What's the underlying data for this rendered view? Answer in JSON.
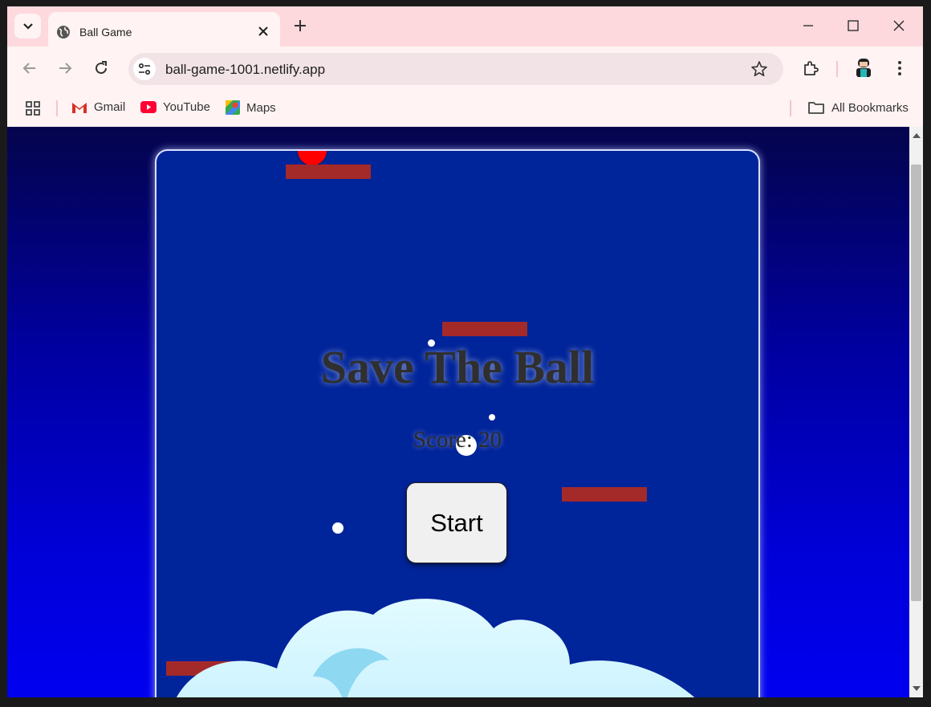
{
  "browser": {
    "tab_title": "Ball Game",
    "url": "ball-game-1001.netlify.app",
    "bookmarks": [
      {
        "label": "Gmail",
        "icon": "gmail-icon"
      },
      {
        "label": "YouTube",
        "icon": "youtube-icon"
      },
      {
        "label": "Maps",
        "icon": "maps-icon"
      }
    ],
    "all_bookmarks_label": "All Bookmarks"
  },
  "game": {
    "title": "Save The Ball",
    "score_text": "Score: 20",
    "start_label": "Start"
  },
  "colors": {
    "tab_strip": "#fdd9dd",
    "toolbar": "#fff3f3",
    "game_background": "#00249a",
    "platform": "#a42a2a",
    "ball": "#ff0000"
  }
}
